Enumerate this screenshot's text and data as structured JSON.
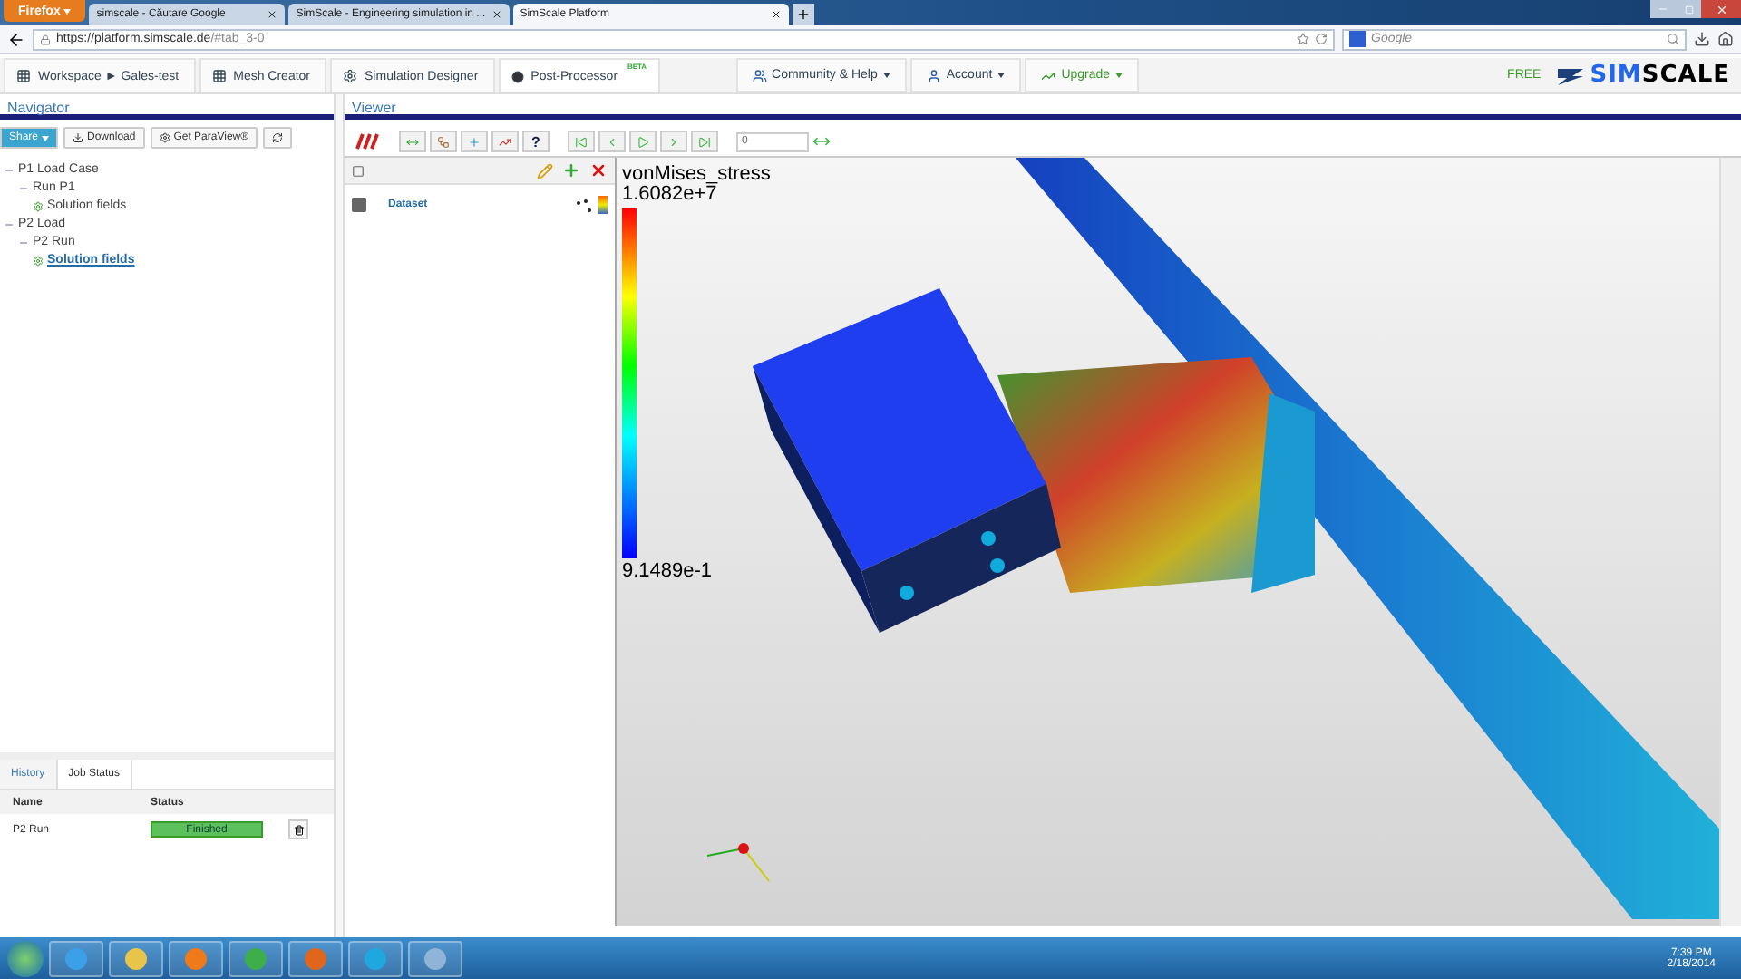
{
  "browser": {
    "menu_button": "Firefox",
    "tabs": [
      {
        "title": "simscale - Căutare Google",
        "selected": false
      },
      {
        "title": "SimScale - Engineering simulation in ...",
        "selected": false
      },
      {
        "title": "SimScale Platform",
        "selected": true
      }
    ],
    "url_host": "https://platform.simscale.de",
    "url_path": "/#tab_3-0",
    "search_placeholder": "Google"
  },
  "app_nav": {
    "tabs": [
      {
        "label": "Workspace ► Gales-test",
        "kind": "workspace",
        "selected": false
      },
      {
        "label": "Mesh Creator",
        "kind": "mesh",
        "selected": false
      },
      {
        "label": "Simulation Designer",
        "kind": "designer",
        "selected": false
      },
      {
        "label": "Post-Processor",
        "kind": "post",
        "badge": "BETA",
        "selected": true
      }
    ],
    "menus": [
      {
        "label": "Community & Help",
        "kind": "community"
      },
      {
        "label": "Account",
        "kind": "account"
      },
      {
        "label": "Upgrade",
        "kind": "upgrade"
      }
    ],
    "plan": "FREE",
    "logo_bold": "SIM",
    "logo_rest": "SCALE"
  },
  "navigator": {
    "title": "Navigator",
    "buttons": [
      {
        "label": "Share",
        "kind": "share"
      },
      {
        "label": "Download",
        "kind": "download"
      },
      {
        "label": "Get ParaView®",
        "kind": "paraview"
      }
    ],
    "tree": [
      {
        "label": "P1 Load Case",
        "selected": false,
        "children": [
          {
            "label": "Run P1",
            "selected": false,
            "children": [
              {
                "label": "Solution fields",
                "selected": false
              }
            ]
          }
        ]
      },
      {
        "label": "P2 Load",
        "selected": false,
        "children": [
          {
            "label": "P2 Run",
            "selected": false,
            "children": [
              {
                "label": "Solution fields",
                "selected": true
              }
            ]
          }
        ]
      }
    ]
  },
  "job_panel": {
    "tabs": [
      {
        "label": "History",
        "selected": false
      },
      {
        "label": "Job Status",
        "selected": true
      }
    ],
    "columns": [
      "Name",
      "Status"
    ],
    "rows": [
      {
        "name": "P2 Run",
        "status": "Finished",
        "level": 1
      }
    ]
  },
  "viewer": {
    "title": "Viewer",
    "help_label": "?",
    "frame": "0",
    "pipeline": [
      {
        "label": "Dataset"
      }
    ],
    "legend": {
      "title": "vonMises_stress",
      "max": "1.6082e+7",
      "min": "9.1489e-1"
    }
  },
  "taskbar": {
    "time": "7:39 PM",
    "date": "2/18/2014"
  }
}
